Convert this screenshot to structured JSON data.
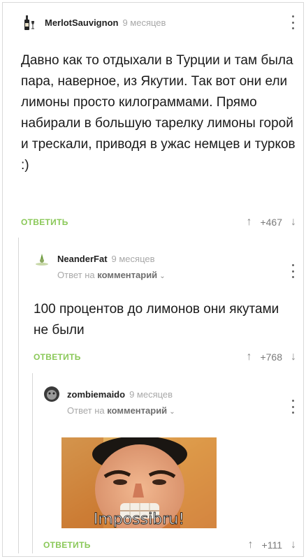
{
  "comments": [
    {
      "username": "MerlotSauvignon",
      "time": "9 месяцев",
      "text": "Давно как то отдыхали в Турции и там была пара, наверное, из Якутии. Так вот они ели лимоны просто килограммами. Прямо набирали в большую тарелку лимоны горой и трескали, приводя в ужас немцев и турков :)",
      "reply_label": "ОТВЕТИТЬ",
      "votes": "+467"
    },
    {
      "username": "NeanderFat",
      "time": "9 месяцев",
      "reply_prefix": "Ответ на",
      "reply_target": "комментарий",
      "text": "100 процентов до лимонов они якутами не были",
      "reply_label": "ОТВЕТИТЬ",
      "votes": "+768"
    },
    {
      "username": "zombiemaido",
      "time": "9 месяцев",
      "reply_prefix": "Ответ на",
      "reply_target": "комментарий",
      "image_caption": "Impossibru!",
      "reply_label": "ОТВЕТИТЬ",
      "votes": "+111"
    }
  ],
  "icons": {
    "upvote": "up-arrow-icon",
    "downvote": "down-arrow-icon",
    "menu": "more-vertical-icon",
    "chevron": "chevron-down-icon"
  },
  "colors": {
    "reply_green": "#8ac858",
    "muted": "#a8a8a8",
    "thread_line": "#d6d6d6"
  }
}
